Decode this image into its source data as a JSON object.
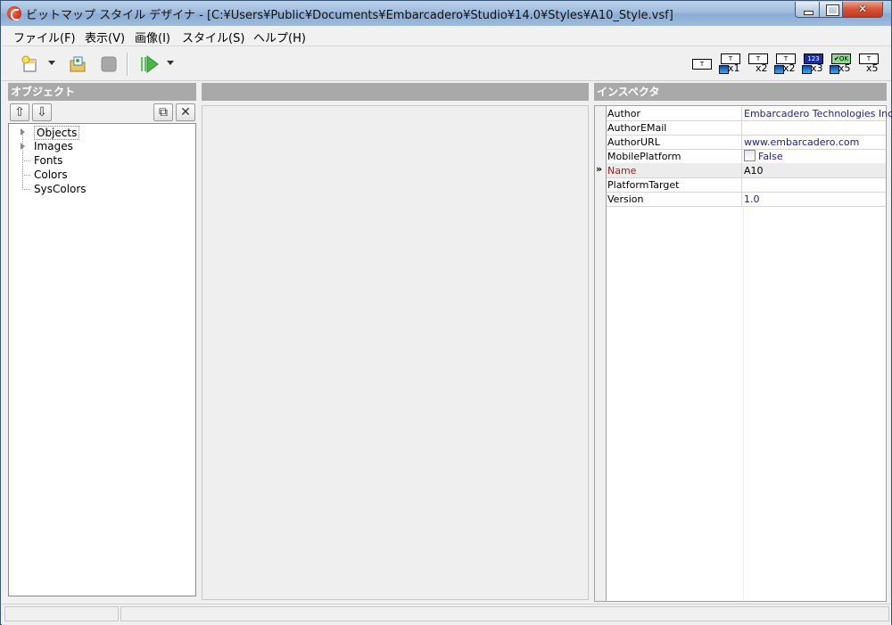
{
  "window": {
    "title": "ビットマップ スタイル デザイナ - [C:¥Users¥Public¥Documents¥Embarcadero¥Studio¥14.0¥Styles¥A10_Style.vsf]",
    "controls": {
      "minimize": "minimize-icon",
      "maximize": "maximize-icon",
      "close": "close-icon"
    }
  },
  "menu": [
    {
      "label": "ファイル(F)"
    },
    {
      "label": "表示(V)"
    },
    {
      "label": "画像(I)"
    },
    {
      "label": "スタイル(S)"
    },
    {
      "label": "ヘルプ(H)"
    }
  ],
  "toolbar": {
    "buttons": [
      "new-style-icon",
      "dropdown-arrow-icon",
      "open-folder-icon",
      "stop-icon",
      "run-icon",
      "dropdown-arrow-icon"
    ],
    "style_buttons": [
      {
        "label": "T",
        "mult": ""
      },
      {
        "label": "T",
        "mult": "x1"
      },
      {
        "label": "T",
        "mult": "x2"
      },
      {
        "label": "T",
        "mult": "x2"
      },
      {
        "label": "123",
        "mult": "x3"
      },
      {
        "label": "✔OK",
        "mult": "x5"
      },
      {
        "label": "T",
        "mult": "x5"
      }
    ]
  },
  "objects_panel": {
    "title": "オブジェクト",
    "tree": [
      {
        "label": "Objects",
        "expandable": true,
        "selected": true
      },
      {
        "label": "Images",
        "expandable": true,
        "selected": false
      },
      {
        "label": "Fonts",
        "expandable": false,
        "selected": false
      },
      {
        "label": "Colors",
        "expandable": false,
        "selected": false
      },
      {
        "label": "SysColors",
        "expandable": false,
        "selected": false
      }
    ]
  },
  "inspector": {
    "title": "インスペクタ",
    "selected_marker": "»",
    "properties": [
      {
        "key": "Author",
        "value": "Embarcadero Technologies Inc."
      },
      {
        "key": "AuthorEMail",
        "value": ""
      },
      {
        "key": "AuthorURL",
        "value": "www.embarcadero.com"
      },
      {
        "key": "MobilePlatform",
        "value": "False"
      },
      {
        "key": "Name",
        "value": "A10"
      },
      {
        "key": "PlatformTarget",
        "value": ""
      },
      {
        "key": "Version",
        "value": "1.0"
      }
    ]
  },
  "colors": {
    "panel_header": "#a9a9a9",
    "link_value": "#1c1c9b",
    "selected_key": "#9b1c1c"
  }
}
